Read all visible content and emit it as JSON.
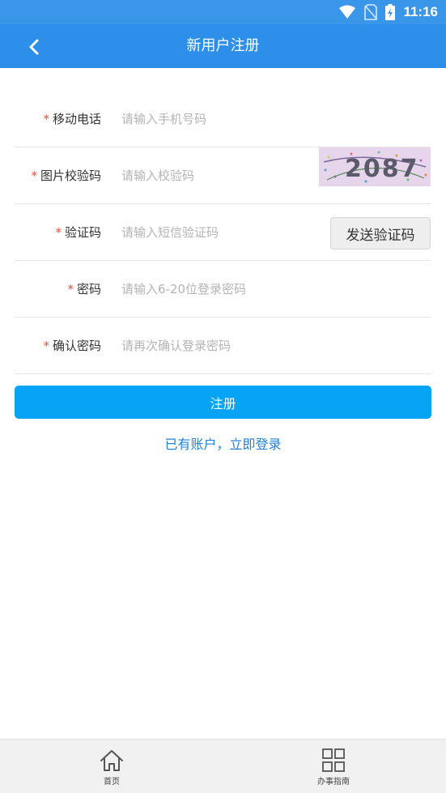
{
  "status_bar": {
    "time": "11:16"
  },
  "app_bar": {
    "title": "新用户注册"
  },
  "form": {
    "required_mark": "*",
    "phone": {
      "label": "移动电话",
      "placeholder": "请输入手机号码"
    },
    "captcha": {
      "label": "图片校验码",
      "placeholder": "请输入校验码",
      "image_text": "2087"
    },
    "sms": {
      "label": "验证码",
      "placeholder": "请输入短信验证码",
      "send_button": "发送验证码"
    },
    "password": {
      "label": "密码",
      "placeholder": "请输入6-20位登录密码"
    },
    "confirm_password": {
      "label": "确认密码",
      "placeholder": "请再次确认登录密码"
    }
  },
  "actions": {
    "submit": "注册",
    "login_link": "已有账户，立即登录"
  },
  "tab_bar": {
    "items": [
      {
        "label": "首页",
        "icon": "home-icon"
      },
      {
        "label": "办事指南",
        "icon": "grid-icon"
      }
    ]
  },
  "colors": {
    "app_bar": "#2e8fea",
    "primary_button": "#07a4f5",
    "required": "#e94f3a",
    "link": "#1f82d8"
  }
}
